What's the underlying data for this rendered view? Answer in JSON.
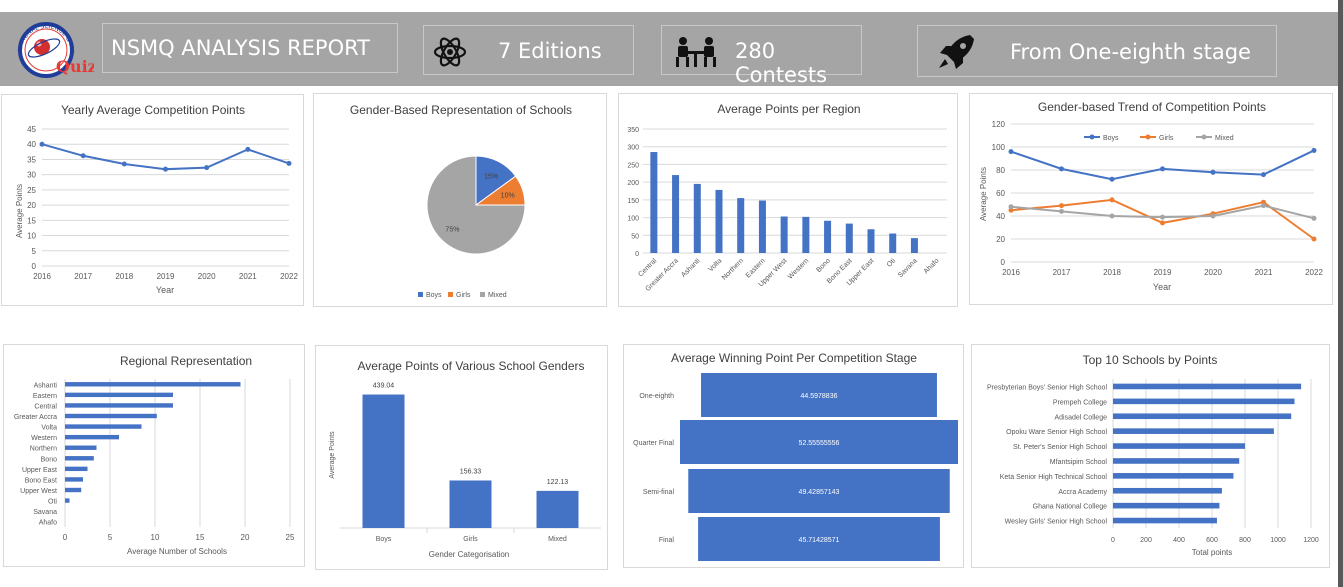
{
  "header": {
    "title": "NSMQ ANALYSIS REPORT",
    "stats": [
      {
        "label": "7 Editions",
        "icon": "atom-icon"
      },
      {
        "label": "280 Contests",
        "icon": "contest-desk-icon"
      },
      {
        "label": "From One-eighth stage",
        "icon": "rocket-icon"
      }
    ],
    "logo_text": "Quiz",
    "logo_ring_text": "NATIONAL SCIENCE & MATHS"
  },
  "colors": {
    "boys": "#4472c4",
    "girls": "#ed7d31",
    "mixed": "#a5a5a5",
    "bar": "#4472c4",
    "banner": "#a5a5a5"
  },
  "chart_data": [
    {
      "id": "yearly",
      "type": "line",
      "title": "Yearly Average Competition Points",
      "xlabel": "Year",
      "ylabel": "Average Points",
      "x": [
        "2016",
        "2017",
        "2018",
        "2019",
        "2020",
        "2021",
        "2022"
      ],
      "values": [
        40,
        36.2,
        33.5,
        31.8,
        32.3,
        38.3,
        33.7
      ],
      "ylim": [
        0,
        45
      ],
      "yticks": [
        0,
        5,
        10,
        15,
        20,
        25,
        30,
        35,
        40,
        45
      ],
      "grid": true
    },
    {
      "id": "gender_pie",
      "type": "pie",
      "title": "Gender-Based Representation of Schools",
      "labels": [
        "Boys",
        "Girls",
        "Mixed"
      ],
      "values": [
        15,
        10,
        75
      ],
      "value_labels": [
        "15%",
        "10%",
        "75%"
      ],
      "legend": "bottom"
    },
    {
      "id": "region_points",
      "type": "bar",
      "title": "Average Points per Region",
      "categories": [
        "Central",
        "Greater Accra",
        "Ashanti",
        "Volta",
        "Northern",
        "Eastern",
        "Upper West",
        "Western",
        "Bono",
        "Bono East",
        "Upper East",
        "Oti",
        "Savana",
        "Ahafo"
      ],
      "values": [
        285,
        220,
        195,
        178,
        155,
        148,
        103,
        102,
        91,
        83,
        67,
        55,
        42,
        0
      ],
      "ylim": [
        0,
        350
      ],
      "yticks": [
        0,
        50,
        100,
        150,
        200,
        250,
        300,
        350
      ],
      "grid": true
    },
    {
      "id": "gender_trend",
      "type": "line",
      "title": "Gender-based Trend of Competition Points",
      "xlabel": "Year",
      "ylabel": "Average Points",
      "x": [
        "2016",
        "2017",
        "2018",
        "2019",
        "2020",
        "2021",
        "2022"
      ],
      "series": [
        {
          "name": "Boys",
          "values": [
            96,
            81,
            72,
            81,
            78,
            76,
            97
          ]
        },
        {
          "name": "Girls",
          "values": [
            45,
            49,
            54,
            34,
            42,
            52,
            20
          ]
        },
        {
          "name": "Mixed",
          "values": [
            48,
            44,
            40,
            39,
            40,
            49,
            38
          ]
        }
      ],
      "ylim": [
        0,
        120
      ],
      "yticks": [
        0,
        20,
        40,
        60,
        80,
        100,
        120
      ],
      "legend": "top",
      "grid": true
    },
    {
      "id": "regional_rep",
      "type": "bar",
      "orientation": "horizontal",
      "title": "Regional Representation",
      "xlabel": "Average Number of Schools",
      "categories": [
        "Ashanti",
        "Eastern",
        "Central",
        "Greater Accra",
        "Volta",
        "Western",
        "Northern",
        "Bono",
        "Upper East",
        "Bono East",
        "Upper West",
        "Oti",
        "Savana",
        "Ahafo"
      ],
      "values": [
        19.5,
        12,
        12,
        10.2,
        8.5,
        6,
        3.5,
        3.2,
        2.5,
        2,
        1.8,
        0.5,
        0,
        0
      ],
      "xlim": [
        0,
        25
      ],
      "xticks": [
        0,
        5,
        10,
        15,
        20,
        25
      ],
      "grid": true
    },
    {
      "id": "gender_avg",
      "type": "bar",
      "title": "Average  Points of Various School Genders",
      "xlabel": "Gender Categorisation",
      "ylabel": "Average Points",
      "categories": [
        "Boys",
        "Girls",
        "Mixed"
      ],
      "values": [
        439.04,
        156.33,
        122.13
      ],
      "value_labels": [
        "439.04",
        "156.33",
        "122.13"
      ],
      "ylim": [
        0,
        500
      ]
    },
    {
      "id": "stage_funnel",
      "type": "bar",
      "orientation": "funnel",
      "title": "Average Winning Point Per Competition Stage",
      "categories": [
        "One-eighth",
        "Quarter Final",
        "Semi-final",
        "Final"
      ],
      "values": [
        44.5978836,
        52.55555556,
        49.42857143,
        45.71428571
      ],
      "value_labels": [
        "44.5978836",
        "52.55555556",
        "49.42857143",
        "45.71428571"
      ]
    },
    {
      "id": "top_schools",
      "type": "bar",
      "orientation": "horizontal",
      "title": "Top 10 Schools by Points",
      "xlabel": "Total points",
      "categories": [
        "Presbyterian Boys' Senior High School",
        "Prempeh College",
        "Adisadel College",
        "Opoku Ware Senior High School",
        "St. Peter's Senior High School",
        "Mfantsipim School",
        "Keta Senior High Technical School",
        "Accra Academy",
        "Ghana National College",
        "Wesley Girls' Senior High School"
      ],
      "values": [
        1140,
        1100,
        1080,
        975,
        800,
        765,
        730,
        660,
        645,
        630
      ],
      "xlim": [
        0,
        1200
      ],
      "xticks": [
        0,
        200,
        400,
        600,
        800,
        1000,
        1200
      ],
      "grid": true
    }
  ]
}
